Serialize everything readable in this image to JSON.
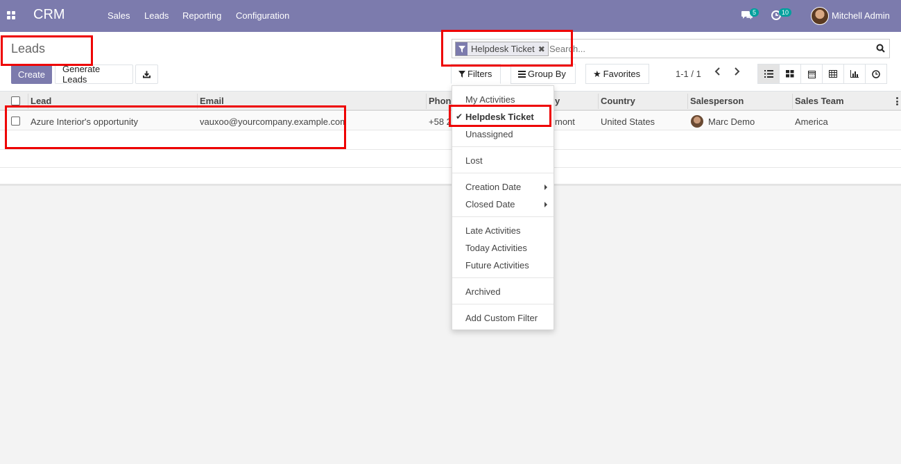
{
  "navbar": {
    "app_name": "CRM",
    "menu": [
      "Sales",
      "Leads",
      "Reporting",
      "Configuration"
    ],
    "messages_count": "5",
    "activities_count": "10",
    "user_name": "Mitchell Admin"
  },
  "control_panel": {
    "title": "Leads",
    "create_label": "Create",
    "generate_label": "Generate Leads",
    "search": {
      "facet_label": "Helpdesk Ticket",
      "placeholder": "Search..."
    },
    "filters_label": "Filters",
    "groupby_label": "Group By",
    "favorites_label": "Favorites",
    "pager": "1-1 / 1"
  },
  "table": {
    "columns": {
      "lead": "Lead",
      "email": "Email",
      "phone": "Phon",
      "city": "y",
      "country": "Country",
      "salesperson": "Salesperson",
      "team": "Sales Team"
    },
    "rows": [
      {
        "lead": "Azure Interior's opportunity",
        "email": "vauxoo@yourcompany.example.com",
        "phone": "+58 2",
        "city": "mont",
        "country": "United States",
        "salesperson": "Marc Demo",
        "team": "America"
      }
    ]
  },
  "filters_menu": {
    "my_activities": "My Activities",
    "helpdesk_ticket": "Helpdesk Ticket",
    "unassigned": "Unassigned",
    "lost": "Lost",
    "creation_date": "Creation Date",
    "closed_date": "Closed Date",
    "late_activities": "Late Activities",
    "today_activities": "Today Activities",
    "future_activities": "Future Activities",
    "archived": "Archived",
    "add_custom_filter": "Add Custom Filter"
  },
  "colors": {
    "brand": "#7c7bad",
    "badge": "#00a09d",
    "annotation": "#ee0000"
  }
}
